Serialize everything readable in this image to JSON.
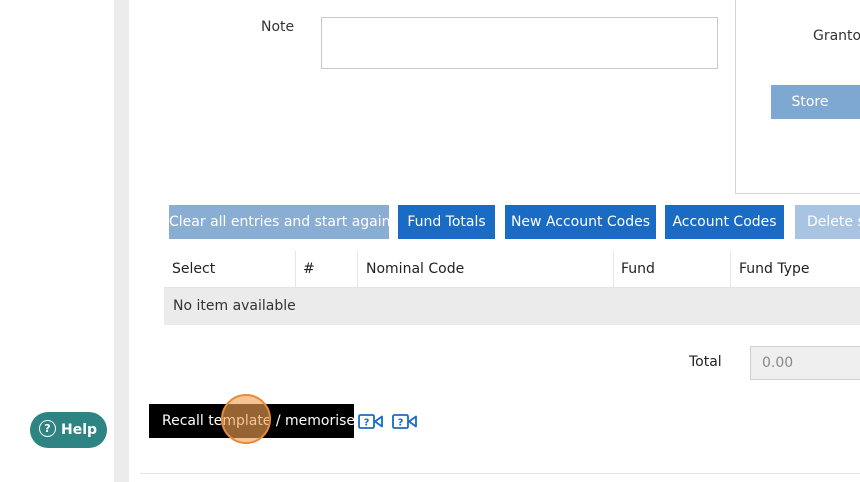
{
  "form": {
    "note_label": "Note",
    "note_value": ""
  },
  "side_panel": {
    "grantor_label": "Grantor",
    "store_label": "Store"
  },
  "actions": {
    "clear_label": "Clear all entries and start again",
    "fund_totals_label": "Fund Totals",
    "new_account_codes_label": "New Account Codes",
    "account_codes_label": "Account Codes",
    "delete_label": "Delete se"
  },
  "table": {
    "columns": [
      "Select",
      "#",
      "Nominal Code",
      "Fund",
      "Fund Type"
    ],
    "empty_text": "No item available"
  },
  "totals": {
    "label": "Total",
    "value": "0.00"
  },
  "footer": {
    "recall_label": "Recall template / memorised",
    "video_icons": [
      "help-video-icon",
      "help-video-icon"
    ]
  },
  "help": {
    "label": "Help",
    "glyph": "?"
  },
  "colors": {
    "primary_button": "#1a6bc4",
    "disabled_button": "#8aaed3",
    "help_button": "#2e8482",
    "click_marker": "#f2a050"
  }
}
